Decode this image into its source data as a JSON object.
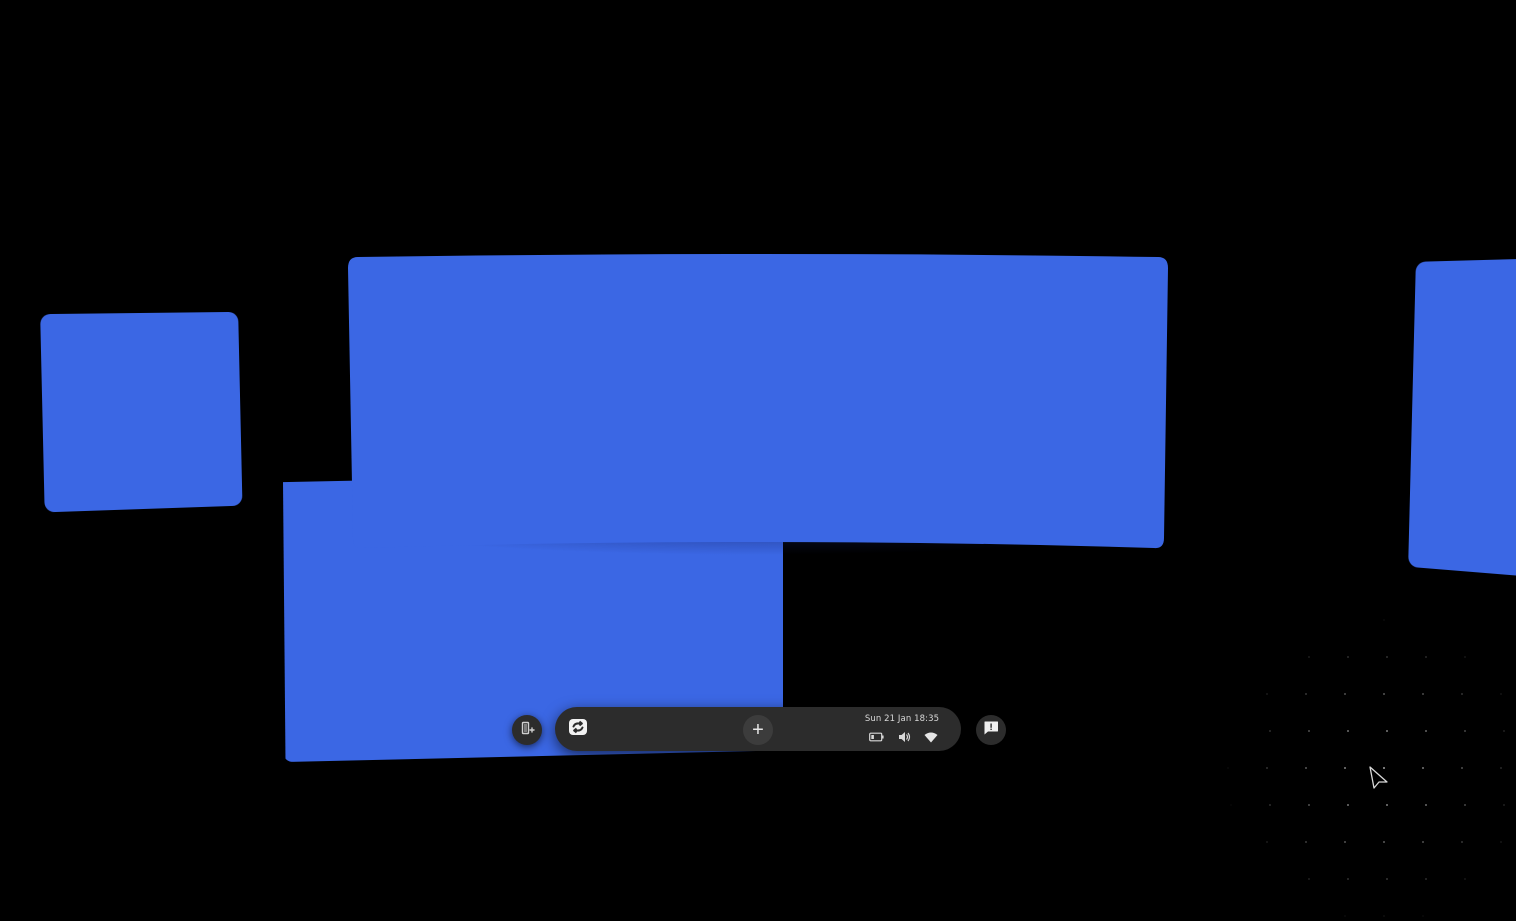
{
  "desktop": {
    "background_color": "#000000",
    "window_color": "#3b67e4"
  },
  "windows": [
    {
      "id": "win-left",
      "name": "window-left"
    },
    {
      "id": "win-bottom",
      "name": "window-bottom"
    },
    {
      "id": "win-main",
      "name": "window-main"
    },
    {
      "id": "win-right",
      "name": "window-right-partial"
    }
  ],
  "taskbar": {
    "background_color": "#2c2c2c",
    "launcher_icon": "launcher-icon",
    "app_icon": "app-switch-icon",
    "add_symbol": "+",
    "clock_text": "Sun 21 Jan 18:35",
    "tray_icons": [
      "battery-icon",
      "volume-icon",
      "wifi-icon"
    ],
    "feedback_icon": "feedback-icon"
  },
  "cursor": {
    "icon": "mouse-pointer-icon"
  }
}
